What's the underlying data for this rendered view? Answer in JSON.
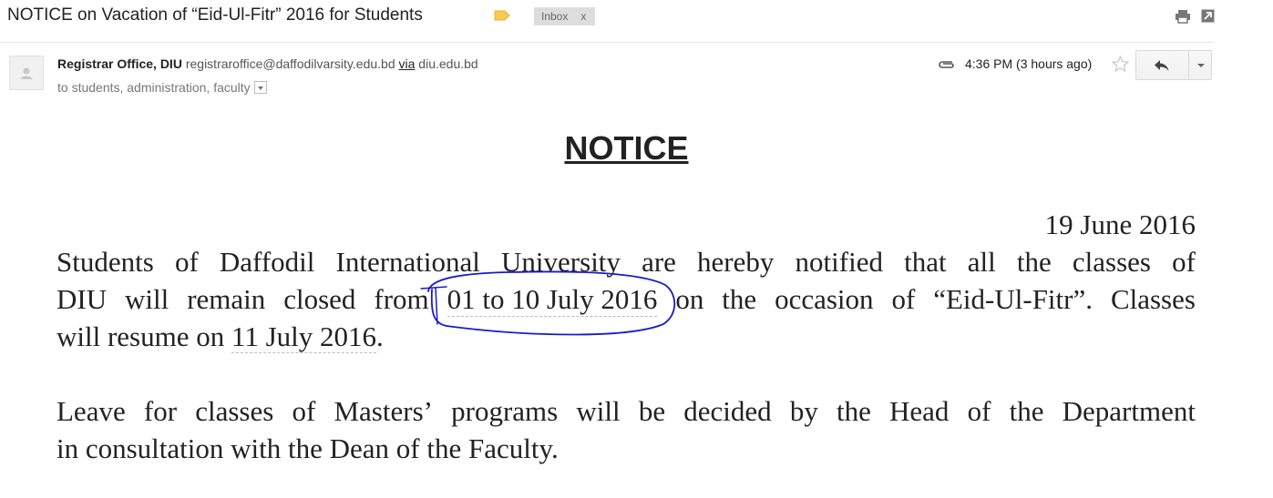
{
  "email": {
    "subject": "NOTICE on Vacation of “Eid-Ul-Fitr” 2016 for Students",
    "label_chip": "Inbox",
    "label_remove": "x",
    "sender_name": "Registrar Office, DIU",
    "sender_email": "registraroffice@daffodilvarsity.edu.bd",
    "via_label": "via",
    "via_domain": "diu.edu.bd",
    "recipients": "to students, administration, faculty",
    "time": "4:36 PM (3 hours ago)"
  },
  "notice": {
    "title": "NOTICE",
    "date": "19 June 2016",
    "p1_line1": [
      "Students",
      "of",
      "Daffodil",
      "International",
      "University",
      "are",
      "hereby",
      "notified",
      "that",
      "all",
      "the",
      "classes",
      "of"
    ],
    "p1_line2": [
      "DIU",
      "will",
      "remain",
      "closed",
      "from",
      "01 to 10 July 2016",
      "on",
      "the",
      "occasion",
      "of",
      "“Eid-Ul-Fitr”.",
      "Classes"
    ],
    "p1_line3_prefix": "will resume on ",
    "p1_line3_date": "11 July 2016",
    "p1_line3_suffix": ".",
    "p2_line1": [
      "Leave",
      "for",
      "classes",
      "of",
      "Masters’",
      "programs",
      "will",
      "be",
      "decided",
      "by",
      "the",
      "Head",
      "of",
      "the",
      "Department"
    ],
    "p2_line2": "in consultation with the Dean of the Faculty."
  },
  "icons": {
    "label_tag": "label-tag-icon",
    "print": "print-icon",
    "new_window": "new-window-icon",
    "avatar": "avatar-icon",
    "attachment": "paperclip-icon",
    "star": "star-icon",
    "reply": "reply-icon",
    "more": "chevron-down-icon",
    "details": "details-dropdown-icon"
  },
  "colors": {
    "label_tag": "#f7cb4d",
    "annotation_ink": "#1a1ac8",
    "chip_bg": "#dddddd"
  }
}
